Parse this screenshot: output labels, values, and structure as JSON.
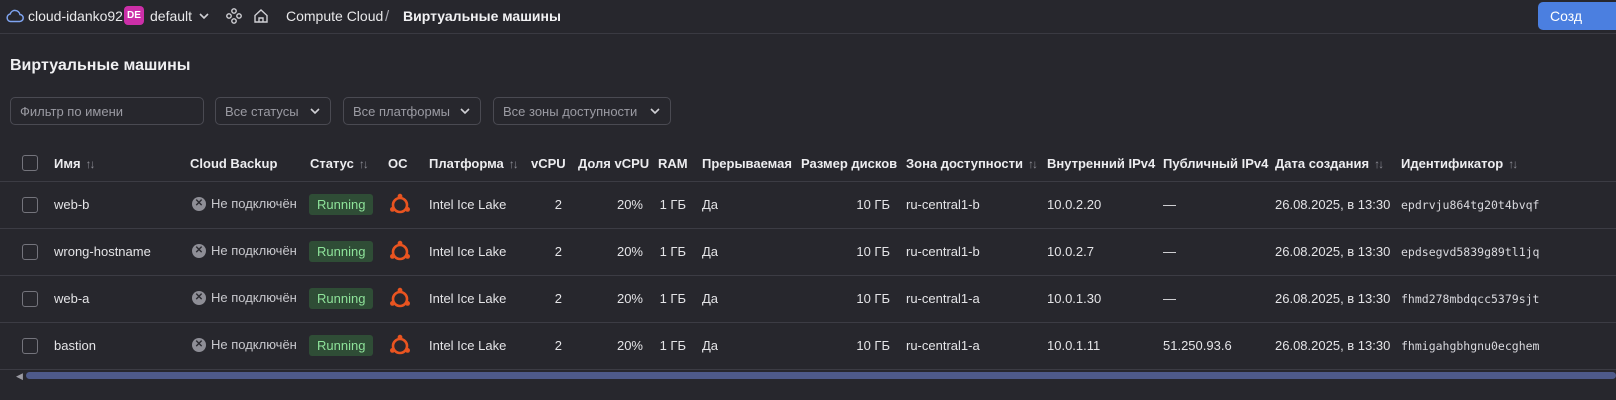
{
  "topbar": {
    "cloud_name": "cloud-idanko92",
    "folder_badge": "DE",
    "folder_name": "default",
    "breadcrumb_service": "Compute Cloud",
    "breadcrumb_sep": "/",
    "breadcrumb_page": "Виртуальные машины",
    "create_button": "Созд",
    "icons": [
      "cloud-icon",
      "chevron-down-icon",
      "services-icon",
      "home-icon"
    ]
  },
  "page": {
    "title": "Виртуальные машины"
  },
  "filters": {
    "name_placeholder": "Фильтр по имени",
    "status": "Все статусы",
    "platform": "Все платформы",
    "zone": "Все зоны доступности"
  },
  "table": {
    "columns": {
      "name": "Имя",
      "backup": "Cloud Backup",
      "status": "Статус",
      "os": "ОС",
      "platform": "Платформа",
      "vcpu": "vCPU",
      "vcpu_share": "Доля vCPU",
      "ram": "RAM",
      "preemptible": "Прерываемая",
      "disk": "Размер дисков",
      "zone": "Зона доступности",
      "ipv4_internal": "Внутренний IPv4",
      "ipv4_public": "Публичный IPv4",
      "created": "Дата создания",
      "id": "Идентификатор"
    },
    "sort_glyph": "↑↓",
    "rows": [
      {
        "name": "web-b",
        "backup": "Не подключён",
        "status": "Running",
        "platform": "Intel Ice Lake",
        "vcpu": "2",
        "vcpu_share": "20%",
        "ram": "1 ГБ",
        "preemptible": "Да",
        "disk": "10 ГБ",
        "zone": "ru-central1-b",
        "ipv4_internal": "10.0.2.20",
        "ipv4_public": "—",
        "created": "26.08.2025, в 13:30",
        "id": "epdrvju864tg20t4bvqf"
      },
      {
        "name": "wrong-hostname",
        "backup": "Не подключён",
        "status": "Running",
        "platform": "Intel Ice Lake",
        "vcpu": "2",
        "vcpu_share": "20%",
        "ram": "1 ГБ",
        "preemptible": "Да",
        "disk": "10 ГБ",
        "zone": "ru-central1-b",
        "ipv4_internal": "10.0.2.7",
        "ipv4_public": "—",
        "created": "26.08.2025, в 13:30",
        "id": "epdsegvd5839g89tl1jq"
      },
      {
        "name": "web-a",
        "backup": "Не подключён",
        "status": "Running",
        "platform": "Intel Ice Lake",
        "vcpu": "2",
        "vcpu_share": "20%",
        "ram": "1 ГБ",
        "preemptible": "Да",
        "disk": "10 ГБ",
        "zone": "ru-central1-a",
        "ipv4_internal": "10.0.1.30",
        "ipv4_public": "—",
        "created": "26.08.2025, в 13:30",
        "id": "fhmd278mbdqcc5379sjt"
      },
      {
        "name": "bastion",
        "backup": "Не подключён",
        "status": "Running",
        "platform": "Intel Ice Lake",
        "vcpu": "2",
        "vcpu_share": "20%",
        "ram": "1 ГБ",
        "preemptible": "Да",
        "disk": "10 ГБ",
        "zone": "ru-central1-a",
        "ipv4_internal": "10.0.1.11",
        "ipv4_public": "51.250.93.6",
        "created": "26.08.2025, в 13:30",
        "id": "fhmigahgbhgnu0ecghem"
      }
    ]
  },
  "colors": {
    "background": "#27272d",
    "accent": "#4b7fe0",
    "folder_badge": "#cc2fa8",
    "running_bg": "#2f4d36",
    "running_text": "#8ee39a",
    "ubuntu": "#e95420"
  }
}
